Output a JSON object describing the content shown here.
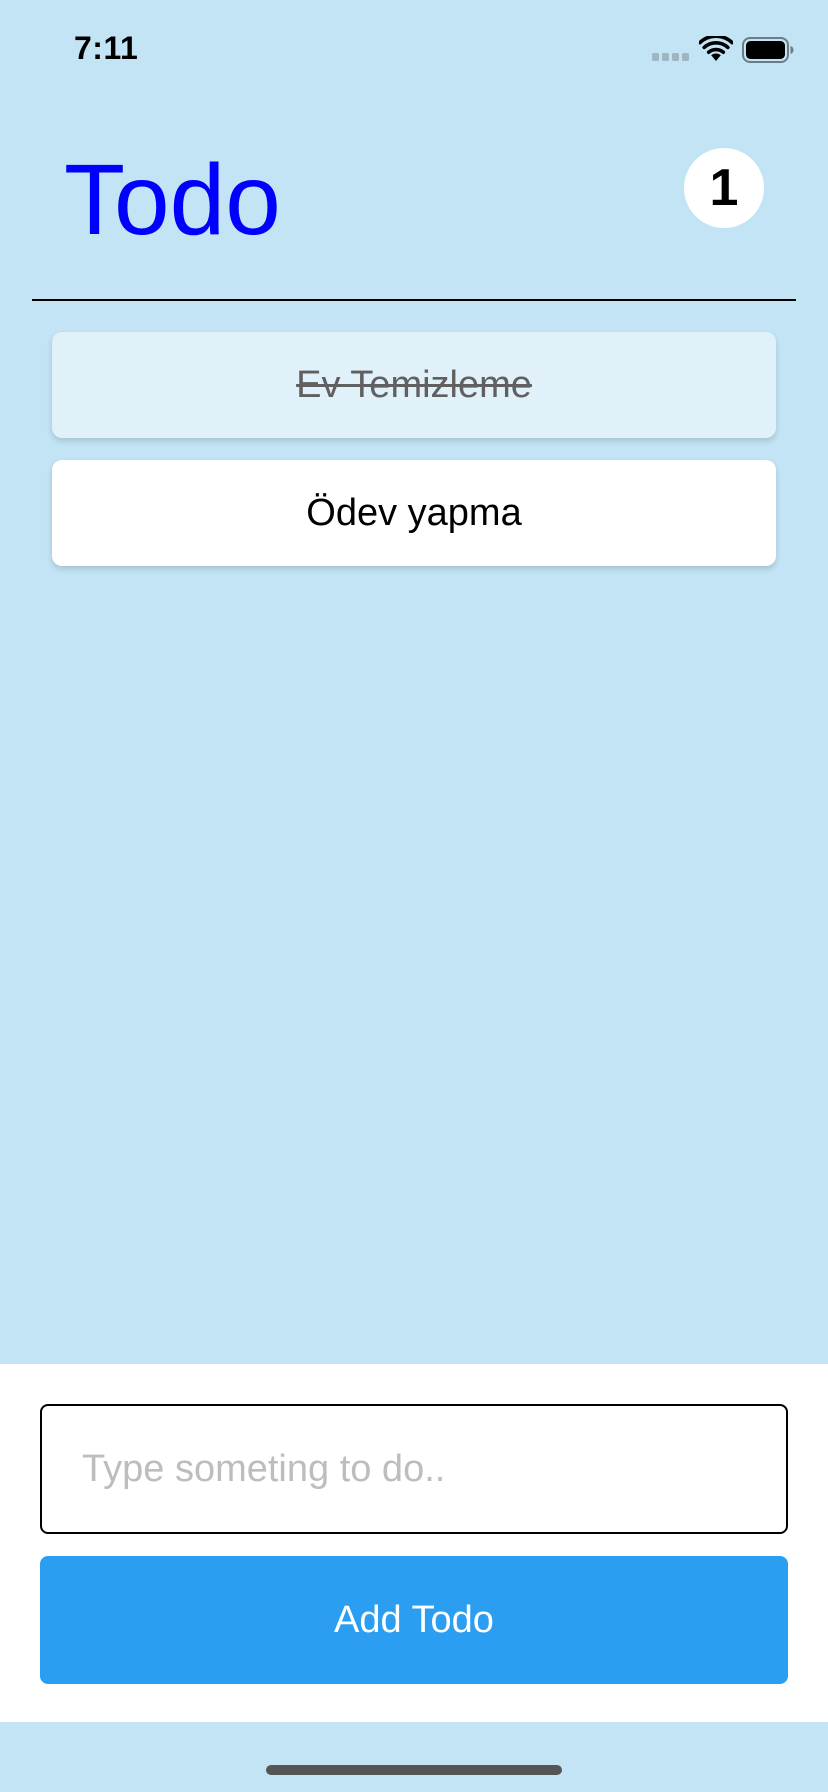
{
  "status_bar": {
    "time": "7:11",
    "signal_icon": "cellular-signal-icon",
    "wifi_icon": "wifi-icon",
    "battery_icon": "battery-icon"
  },
  "header": {
    "title": "Todo",
    "title_color": "#0000FF",
    "remaining_count": "1"
  },
  "todos": [
    {
      "text": "Ev Temizleme",
      "completed": true
    },
    {
      "text": "Ödev yapma",
      "completed": false
    }
  ],
  "input": {
    "value": "",
    "placeholder": "Type someting to do.."
  },
  "add_button": {
    "label": "Add Todo",
    "color": "#2B9EF1"
  },
  "colors": {
    "background": "#C2E4F4",
    "completed_item": "#E0F1F9",
    "item": "#FFFFFF"
  }
}
